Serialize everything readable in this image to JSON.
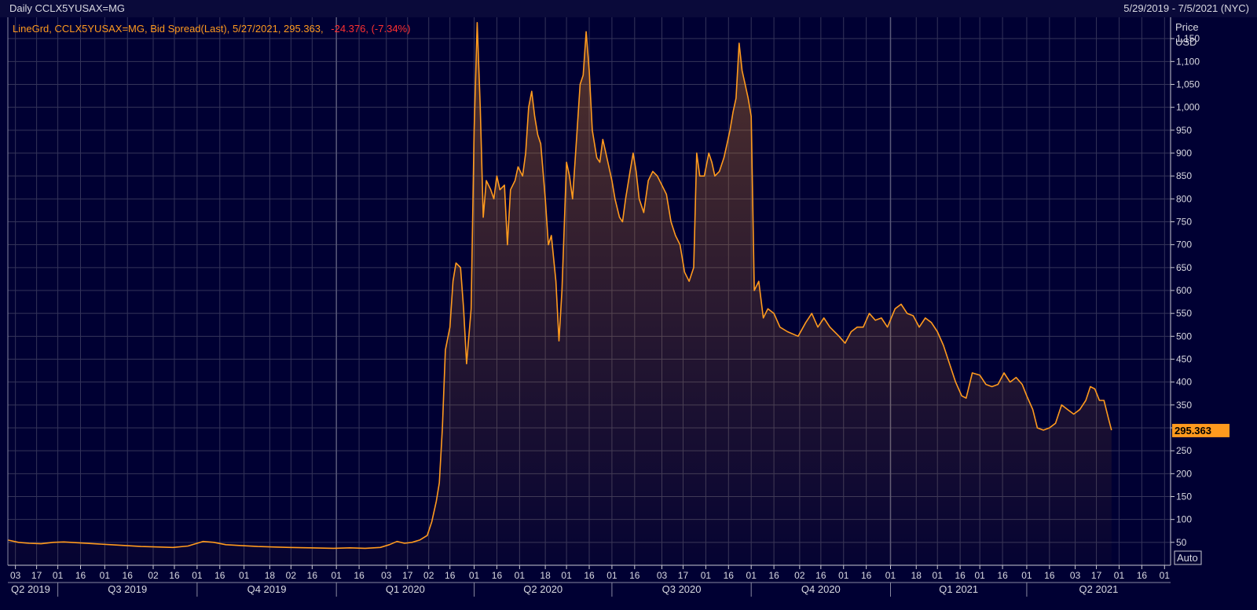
{
  "header": {
    "chart_label": "Daily CCLX5YUSAX=MG",
    "date_range": "5/29/2019 - 7/5/2021 (NYC)"
  },
  "legend": {
    "main": "LineGrd, CCLX5YUSAX=MG, Bid Spread(Last), 5/27/2021, 295.363,",
    "change": "-24.376, (-7.34%)"
  },
  "axis_title": [
    "Price",
    "USD"
  ],
  "auto_label": "Auto",
  "last_value_label": "295.363",
  "colors": {
    "background": "#000033",
    "line": "#ff9a1e",
    "grid": "#34345a",
    "change": "#ff3030",
    "badge": "#ff9a1e"
  },
  "chart_data": {
    "type": "area",
    "title": "Daily CCLX5YUSAX=MG",
    "series_name": "CCLX5YUSAX=MG, Bid Spread(Last)",
    "ylabel": "Price USD",
    "xlabel": "",
    "ylim": [
      0,
      1200
    ],
    "yticks": [
      50,
      100,
      150,
      200,
      250,
      300,
      350,
      400,
      450,
      500,
      550,
      600,
      650,
      700,
      750,
      800,
      850,
      900,
      950,
      1000,
      1050,
      1100,
      1150
    ],
    "xlim": [
      "2019-05-29",
      "2021-07-05"
    ],
    "x_tick_labels": [
      {
        "date": "2019-06-03",
        "label": "03"
      },
      {
        "date": "2019-06-17",
        "label": "17"
      },
      {
        "date": "2019-07-01",
        "label": "01"
      },
      {
        "date": "2019-07-16",
        "label": "16"
      },
      {
        "date": "2019-08-01",
        "label": "01"
      },
      {
        "date": "2019-08-16",
        "label": "16"
      },
      {
        "date": "2019-09-02",
        "label": "02"
      },
      {
        "date": "2019-09-16",
        "label": "16"
      },
      {
        "date": "2019-10-01",
        "label": "01"
      },
      {
        "date": "2019-10-16",
        "label": "16"
      },
      {
        "date": "2019-11-01",
        "label": "01"
      },
      {
        "date": "2019-11-18",
        "label": "18"
      },
      {
        "date": "2019-12-02",
        "label": "02"
      },
      {
        "date": "2019-12-16",
        "label": "16"
      },
      {
        "date": "2020-01-01",
        "label": "01"
      },
      {
        "date": "2020-01-16",
        "label": "16"
      },
      {
        "date": "2020-02-03",
        "label": "03"
      },
      {
        "date": "2020-02-17",
        "label": "17"
      },
      {
        "date": "2020-03-02",
        "label": "02"
      },
      {
        "date": "2020-03-16",
        "label": "16"
      },
      {
        "date": "2020-04-01",
        "label": "01"
      },
      {
        "date": "2020-04-16",
        "label": "16"
      },
      {
        "date": "2020-05-01",
        "label": "01"
      },
      {
        "date": "2020-05-18",
        "label": "18"
      },
      {
        "date": "2020-06-01",
        "label": "01"
      },
      {
        "date": "2020-06-16",
        "label": "16"
      },
      {
        "date": "2020-07-01",
        "label": "01"
      },
      {
        "date": "2020-07-16",
        "label": "16"
      },
      {
        "date": "2020-08-03",
        "label": "03"
      },
      {
        "date": "2020-08-17",
        "label": "17"
      },
      {
        "date": "2020-09-01",
        "label": "01"
      },
      {
        "date": "2020-09-16",
        "label": "16"
      },
      {
        "date": "2020-10-01",
        "label": "01"
      },
      {
        "date": "2020-10-16",
        "label": "16"
      },
      {
        "date": "2020-11-02",
        "label": "02"
      },
      {
        "date": "2020-11-16",
        "label": "16"
      },
      {
        "date": "2020-12-01",
        "label": "01"
      },
      {
        "date": "2020-12-16",
        "label": "16"
      },
      {
        "date": "2021-01-01",
        "label": "01"
      },
      {
        "date": "2021-01-18",
        "label": "18"
      },
      {
        "date": "2021-02-01",
        "label": "01"
      },
      {
        "date": "2021-02-16",
        "label": "16"
      },
      {
        "date": "2021-03-01",
        "label": "01"
      },
      {
        "date": "2021-03-16",
        "label": "16"
      },
      {
        "date": "2021-04-01",
        "label": "01"
      },
      {
        "date": "2021-04-16",
        "label": "16"
      },
      {
        "date": "2021-05-03",
        "label": "03"
      },
      {
        "date": "2021-05-17",
        "label": "17"
      },
      {
        "date": "2021-06-01",
        "label": "01"
      },
      {
        "date": "2021-06-16",
        "label": "16"
      },
      {
        "date": "2021-07-01",
        "label": "01"
      }
    ],
    "quarters": [
      {
        "label": "Q2 2019",
        "start": "2019-05-29",
        "end": "2019-07-01"
      },
      {
        "label": "Q3 2019",
        "start": "2019-07-01",
        "end": "2019-10-01"
      },
      {
        "label": "Q4 2019",
        "start": "2019-10-01",
        "end": "2020-01-01"
      },
      {
        "label": "Q1 2020",
        "start": "2020-01-01",
        "end": "2020-04-01"
      },
      {
        "label": "Q2 2020",
        "start": "2020-04-01",
        "end": "2020-07-01"
      },
      {
        "label": "Q3 2020",
        "start": "2020-07-01",
        "end": "2020-10-01"
      },
      {
        "label": "Q4 2020",
        "start": "2020-10-01",
        "end": "2021-01-01"
      },
      {
        "label": "Q1 2021",
        "start": "2021-01-01",
        "end": "2021-04-01"
      },
      {
        "label": "Q2 2021",
        "start": "2021-04-01",
        "end": "2021-07-05"
      }
    ],
    "year_dividers": [
      "2020-01-01",
      "2021-01-01"
    ],
    "series": [
      [
        "2019-05-29",
        55
      ],
      [
        "2019-06-05",
        50
      ],
      [
        "2019-06-12",
        48
      ],
      [
        "2019-06-20",
        47
      ],
      [
        "2019-06-28",
        50
      ],
      [
        "2019-07-05",
        51
      ],
      [
        "2019-07-15",
        49
      ],
      [
        "2019-07-25",
        47
      ],
      [
        "2019-08-05",
        45
      ],
      [
        "2019-08-15",
        43
      ],
      [
        "2019-08-25",
        41
      ],
      [
        "2019-09-05",
        40
      ],
      [
        "2019-09-15",
        39
      ],
      [
        "2019-09-25",
        42
      ],
      [
        "2019-10-01",
        48
      ],
      [
        "2019-10-05",
        52
      ],
      [
        "2019-10-12",
        50
      ],
      [
        "2019-10-20",
        45
      ],
      [
        "2019-10-30",
        43
      ],
      [
        "2019-11-10",
        41
      ],
      [
        "2019-11-20",
        40
      ],
      [
        "2019-12-01",
        39
      ],
      [
        "2019-12-15",
        38
      ],
      [
        "2019-12-30",
        37
      ],
      [
        "2020-01-10",
        38
      ],
      [
        "2020-01-20",
        37
      ],
      [
        "2020-01-30",
        39
      ],
      [
        "2020-02-05",
        45
      ],
      [
        "2020-02-10",
        52
      ],
      [
        "2020-02-15",
        48
      ],
      [
        "2020-02-20",
        50
      ],
      [
        "2020-02-25",
        55
      ],
      [
        "2020-03-01",
        65
      ],
      [
        "2020-03-04",
        95
      ],
      [
        "2020-03-07",
        140
      ],
      [
        "2020-03-09",
        180
      ],
      [
        "2020-03-11",
        300
      ],
      [
        "2020-03-13",
        470
      ],
      [
        "2020-03-16",
        520
      ],
      [
        "2020-03-18",
        620
      ],
      [
        "2020-03-20",
        660
      ],
      [
        "2020-03-23",
        650
      ],
      [
        "2020-03-25",
        560
      ],
      [
        "2020-03-27",
        440
      ],
      [
        "2020-03-30",
        560
      ],
      [
        "2020-04-01",
        950
      ],
      [
        "2020-04-03",
        1185
      ],
      [
        "2020-04-05",
        1000
      ],
      [
        "2020-04-07",
        760
      ],
      [
        "2020-04-09",
        840
      ],
      [
        "2020-04-12",
        820
      ],
      [
        "2020-04-14",
        800
      ],
      [
        "2020-04-16",
        850
      ],
      [
        "2020-04-18",
        820
      ],
      [
        "2020-04-21",
        830
      ],
      [
        "2020-04-23",
        700
      ],
      [
        "2020-04-25",
        820
      ],
      [
        "2020-04-28",
        840
      ],
      [
        "2020-04-30",
        870
      ],
      [
        "2020-05-03",
        850
      ],
      [
        "2020-05-05",
        900
      ],
      [
        "2020-05-07",
        1000
      ],
      [
        "2020-05-09",
        1035
      ],
      [
        "2020-05-11",
        980
      ],
      [
        "2020-05-13",
        940
      ],
      [
        "2020-05-15",
        920
      ],
      [
        "2020-05-18",
        800
      ],
      [
        "2020-05-20",
        700
      ],
      [
        "2020-05-22",
        720
      ],
      [
        "2020-05-25",
        620
      ],
      [
        "2020-05-27",
        490
      ],
      [
        "2020-05-29",
        600
      ],
      [
        "2020-06-01",
        880
      ],
      [
        "2020-06-03",
        850
      ],
      [
        "2020-06-05",
        800
      ],
      [
        "2020-06-08",
        950
      ],
      [
        "2020-06-10",
        1050
      ],
      [
        "2020-06-12",
        1070
      ],
      [
        "2020-06-14",
        1165
      ],
      [
        "2020-06-16",
        1080
      ],
      [
        "2020-06-18",
        950
      ],
      [
        "2020-06-21",
        890
      ],
      [
        "2020-06-23",
        880
      ],
      [
        "2020-06-25",
        930
      ],
      [
        "2020-06-27",
        900
      ],
      [
        "2020-07-01",
        840
      ],
      [
        "2020-07-03",
        800
      ],
      [
        "2020-07-06",
        760
      ],
      [
        "2020-07-08",
        750
      ],
      [
        "2020-07-10",
        800
      ],
      [
        "2020-07-13",
        860
      ],
      [
        "2020-07-15",
        900
      ],
      [
        "2020-07-17",
        860
      ],
      [
        "2020-07-19",
        800
      ],
      [
        "2020-07-22",
        770
      ],
      [
        "2020-07-25",
        840
      ],
      [
        "2020-07-28",
        860
      ],
      [
        "2020-07-31",
        850
      ],
      [
        "2020-08-03",
        830
      ],
      [
        "2020-08-06",
        810
      ],
      [
        "2020-08-09",
        750
      ],
      [
        "2020-08-12",
        720
      ],
      [
        "2020-08-15",
        700
      ],
      [
        "2020-08-18",
        640
      ],
      [
        "2020-08-21",
        620
      ],
      [
        "2020-08-24",
        650
      ],
      [
        "2020-08-26",
        900
      ],
      [
        "2020-08-28",
        850
      ],
      [
        "2020-08-31",
        850
      ],
      [
        "2020-09-03",
        900
      ],
      [
        "2020-09-05",
        880
      ],
      [
        "2020-09-07",
        850
      ],
      [
        "2020-09-10",
        860
      ],
      [
        "2020-09-13",
        890
      ],
      [
        "2020-09-15",
        920
      ],
      [
        "2020-09-17",
        950
      ],
      [
        "2020-09-19",
        990
      ],
      [
        "2020-09-21",
        1020
      ],
      [
        "2020-09-23",
        1140
      ],
      [
        "2020-09-25",
        1080
      ],
      [
        "2020-09-27",
        1050
      ],
      [
        "2020-09-29",
        1020
      ],
      [
        "2020-10-01",
        980
      ],
      [
        "2020-10-03",
        600
      ],
      [
        "2020-10-06",
        620
      ],
      [
        "2020-10-09",
        540
      ],
      [
        "2020-10-12",
        560
      ],
      [
        "2020-10-16",
        550
      ],
      [
        "2020-10-20",
        520
      ],
      [
        "2020-10-25",
        510
      ],
      [
        "2020-11-01",
        500
      ],
      [
        "2020-11-06",
        530
      ],
      [
        "2020-11-10",
        550
      ],
      [
        "2020-11-14",
        520
      ],
      [
        "2020-11-18",
        540
      ],
      [
        "2020-11-22",
        520
      ],
      [
        "2020-11-28",
        500
      ],
      [
        "2020-12-02",
        485
      ],
      [
        "2020-12-06",
        510
      ],
      [
        "2020-12-10",
        520
      ],
      [
        "2020-12-14",
        520
      ],
      [
        "2020-12-18",
        550
      ],
      [
        "2020-12-22",
        535
      ],
      [
        "2020-12-26",
        540
      ],
      [
        "2020-12-30",
        520
      ],
      [
        "2021-01-04",
        560
      ],
      [
        "2021-01-08",
        570
      ],
      [
        "2021-01-12",
        550
      ],
      [
        "2021-01-16",
        545
      ],
      [
        "2021-01-20",
        520
      ],
      [
        "2021-01-24",
        540
      ],
      [
        "2021-01-28",
        530
      ],
      [
        "2021-02-01",
        510
      ],
      [
        "2021-02-05",
        480
      ],
      [
        "2021-02-09",
        440
      ],
      [
        "2021-02-13",
        400
      ],
      [
        "2021-02-17",
        370
      ],
      [
        "2021-02-20",
        365
      ],
      [
        "2021-02-24",
        420
      ],
      [
        "2021-03-01",
        415
      ],
      [
        "2021-03-05",
        395
      ],
      [
        "2021-03-09",
        390
      ],
      [
        "2021-03-13",
        395
      ],
      [
        "2021-03-17",
        420
      ],
      [
        "2021-03-21",
        400
      ],
      [
        "2021-03-25",
        410
      ],
      [
        "2021-03-29",
        395
      ],
      [
        "2021-04-01",
        370
      ],
      [
        "2021-04-05",
        340
      ],
      [
        "2021-04-08",
        300
      ],
      [
        "2021-04-12",
        295
      ],
      [
        "2021-04-16",
        300
      ],
      [
        "2021-04-20",
        310
      ],
      [
        "2021-04-24",
        350
      ],
      [
        "2021-04-28",
        340
      ],
      [
        "2021-05-02",
        330
      ],
      [
        "2021-05-06",
        340
      ],
      [
        "2021-05-10",
        360
      ],
      [
        "2021-05-13",
        390
      ],
      [
        "2021-05-16",
        385
      ],
      [
        "2021-05-19",
        360
      ],
      [
        "2021-05-22",
        360
      ],
      [
        "2021-05-25",
        320
      ],
      [
        "2021-05-27",
        295
      ]
    ]
  }
}
